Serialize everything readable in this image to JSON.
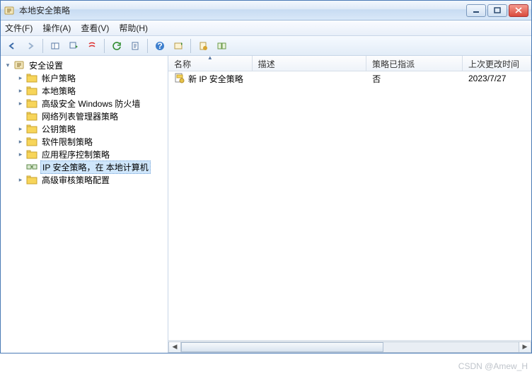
{
  "window": {
    "title": "本地安全策略"
  },
  "menu": {
    "file": "文件(F)",
    "action": "操作(A)",
    "view": "查看(V)",
    "help": "帮助(H)"
  },
  "tree": {
    "root": "安全设置",
    "items": [
      {
        "label": "帐户策略",
        "expandable": true
      },
      {
        "label": "本地策略",
        "expandable": true
      },
      {
        "label": "高级安全 Windows 防火墙",
        "expandable": true
      },
      {
        "label": "网络列表管理器策略",
        "expandable": false
      },
      {
        "label": "公钥策略",
        "expandable": true
      },
      {
        "label": "软件限制策略",
        "expandable": true
      },
      {
        "label": "应用程序控制策略",
        "expandable": true
      },
      {
        "label": "IP 安全策略，在 本地计算机",
        "expandable": false,
        "selected": true,
        "icon": "ipsec"
      },
      {
        "label": "高级审核策略配置",
        "expandable": true
      }
    ]
  },
  "columns": {
    "name": "名称",
    "desc": "描述",
    "assigned": "策略已指派",
    "modified": "上次更改时间"
  },
  "rows": [
    {
      "name": "新 IP 安全策略",
      "desc": "",
      "assigned": "否",
      "modified": "2023/7/27 "
    }
  ],
  "watermark": "CSDN @Amew_H",
  "colwidths": {
    "name": 135,
    "desc": 185,
    "assigned": 155,
    "modified": 110
  }
}
